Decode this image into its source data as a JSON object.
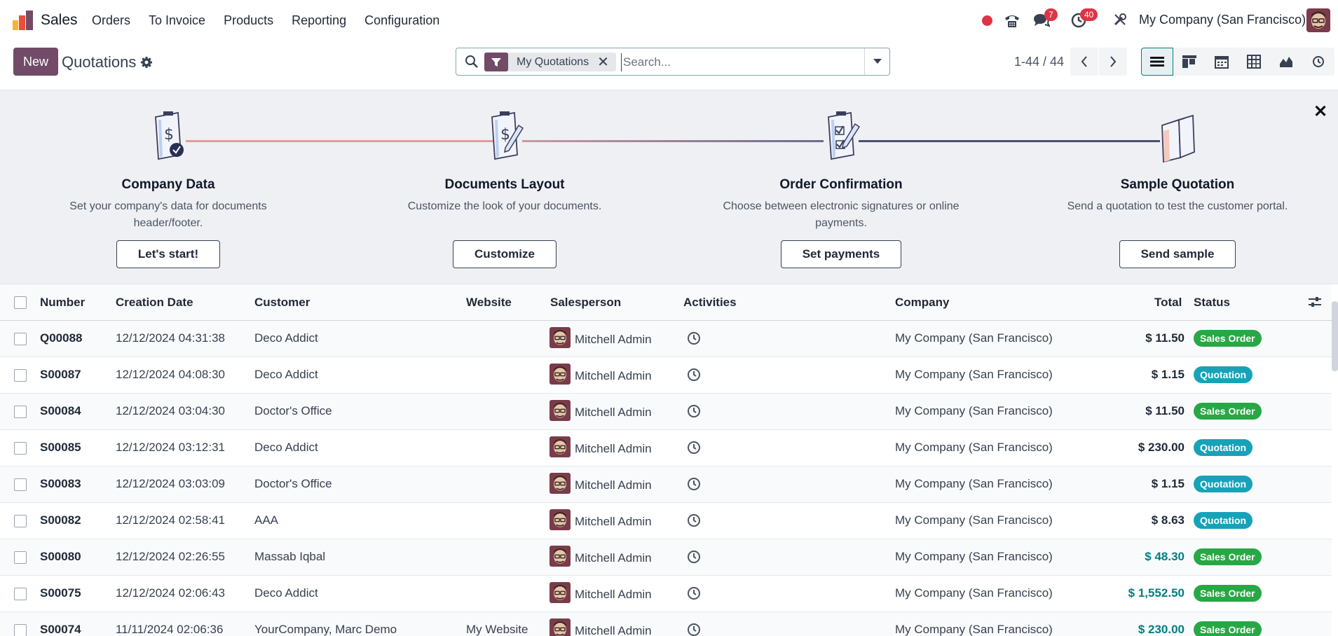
{
  "app": {
    "name": "Sales"
  },
  "menu": [
    "Orders",
    "To Invoice",
    "Products",
    "Reporting",
    "Configuration"
  ],
  "systray": {
    "messages_count": "7",
    "activities_count": "40",
    "company": "My Company (San Francisco)"
  },
  "control": {
    "new_label": "New",
    "title": "Quotations",
    "facet_label": "My Quotations",
    "search_placeholder": "Search...",
    "pager": "1-44 / 44"
  },
  "onboarding": [
    {
      "title": "Company Data",
      "desc": "Set your company's data for documents header/footer.",
      "button": "Let's start!"
    },
    {
      "title": "Documents Layout",
      "desc": "Customize the look of your documents.",
      "button": "Customize"
    },
    {
      "title": "Order Confirmation",
      "desc": "Choose between electronic signatures or online payments.",
      "button": "Set payments"
    },
    {
      "title": "Sample Quotation",
      "desc": "Send a quotation to test the customer portal.",
      "button": "Send sample"
    }
  ],
  "table": {
    "headers": {
      "number": "Number",
      "date": "Creation Date",
      "customer": "Customer",
      "website": "Website",
      "salesperson": "Salesperson",
      "activities": "Activities",
      "company": "Company",
      "total": "Total",
      "status": "Status"
    },
    "rows": [
      {
        "number": "Q00088",
        "date": "12/12/2024 04:31:38",
        "customer": "Deco Addict",
        "website": "",
        "salesperson": "Mitchell Admin",
        "company": "My Company (San Francisco)",
        "total": "$ 11.50",
        "status": "Sales Order"
      },
      {
        "number": "S00087",
        "date": "12/12/2024 04:08:30",
        "customer": "Deco Addict",
        "website": "",
        "salesperson": "Mitchell Admin",
        "company": "My Company (San Francisco)",
        "total": "$ 1.15",
        "status": "Quotation"
      },
      {
        "number": "S00084",
        "date": "12/12/2024 03:04:30",
        "customer": "Doctor's Office",
        "website": "",
        "salesperson": "Mitchell Admin",
        "company": "My Company (San Francisco)",
        "total": "$ 11.50",
        "status": "Sales Order"
      },
      {
        "number": "S00085",
        "date": "12/12/2024 03:12:31",
        "customer": "Deco Addict",
        "website": "",
        "salesperson": "Mitchell Admin",
        "company": "My Company (San Francisco)",
        "total": "$ 230.00",
        "status": "Quotation"
      },
      {
        "number": "S00083",
        "date": "12/12/2024 03:03:09",
        "customer": "Doctor's Office",
        "website": "",
        "salesperson": "Mitchell Admin",
        "company": "My Company (San Francisco)",
        "total": "$ 1.15",
        "status": "Quotation"
      },
      {
        "number": "S00082",
        "date": "12/12/2024 02:58:41",
        "customer": "AAA",
        "website": "",
        "salesperson": "Mitchell Admin",
        "company": "My Company (San Francisco)",
        "total": "$ 8.63",
        "status": "Quotation"
      },
      {
        "number": "S00080",
        "date": "12/12/2024 02:26:55",
        "customer": "Massab Iqbal",
        "website": "",
        "salesperson": "Mitchell Admin",
        "company": "My Company (San Francisco)",
        "total": "$ 48.30",
        "status": "Sales Order"
      },
      {
        "number": "S00075",
        "date": "12/12/2024 02:06:43",
        "customer": "Deco Addict",
        "website": "",
        "salesperson": "Mitchell Admin",
        "company": "My Company (San Francisco)",
        "total": "$ 1,552.50",
        "status": "Sales Order"
      },
      {
        "number": "S00074",
        "date": "11/11/2024 02:06:36",
        "customer": "YourCompany, Marc Demo",
        "website": "My Website",
        "salesperson": "Mitchell Admin",
        "company": "My Company (San Francisco)",
        "total": "$ 230.00",
        "status": "Sales Order"
      }
    ],
    "total_colors": [
      "#1f2937",
      "#1f2937",
      "#1f2937",
      "#1f2937",
      "#1f2937",
      "#1f2937",
      "#017e84",
      "#017e84",
      "#017e84"
    ]
  },
  "colors": {
    "brand": "#714b67",
    "accent": "#017e84",
    "sales_order": "#28a745",
    "quotation": "#17a2b8"
  },
  "icons": [
    "sales-app-logo-icon",
    "search-icon",
    "filter-icon",
    "close-icon",
    "caret-down-icon",
    "chevron-left-icon",
    "chevron-right-icon",
    "gear-icon",
    "list-view-icon",
    "kanban-view-icon",
    "calendar-view-icon",
    "pivot-view-icon",
    "graph-view-icon",
    "activity-view-icon",
    "clock-icon",
    "phone-icon",
    "chat-icon",
    "activity-clock-icon",
    "tools-icon",
    "optional-columns-icon"
  ]
}
